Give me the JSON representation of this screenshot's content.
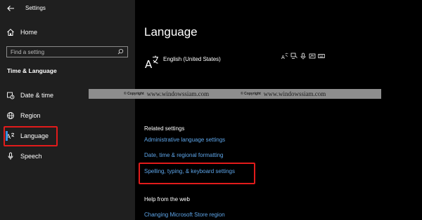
{
  "window": {
    "title": "Settings"
  },
  "sidebar": {
    "home_label": "Home",
    "search_placeholder": "Find a setting",
    "section_title": "Time & Language",
    "items": [
      {
        "label": "Date & time",
        "icon": "calendar-clock-icon"
      },
      {
        "label": "Region",
        "icon": "globe-icon"
      },
      {
        "label": "Language",
        "icon": "language-icon",
        "selected": true
      },
      {
        "label": "Speech",
        "icon": "microphone-icon"
      }
    ]
  },
  "main": {
    "page_title": "Language",
    "language_entry": {
      "name": "English (United States)",
      "icon": "language-icon"
    },
    "feature_icons": [
      "language-pack-icon",
      "text-to-speech-icon",
      "speech-recognition-icon",
      "handwriting-icon",
      "keyboard-icon"
    ],
    "related_settings": {
      "title": "Related settings",
      "links": [
        "Administrative language settings",
        "Date, time & regional formatting",
        "Spelling, typing, & keyboard settings"
      ]
    },
    "help_web": {
      "title": "Help from the web",
      "links": [
        "Changing Microsoft Store region"
      ]
    }
  },
  "watermark": {
    "copyright_label": "© Copyright",
    "site": "www.windowssiam.com"
  },
  "colors": {
    "sidebar_bg": "#1f1f1f",
    "main_bg": "#000000",
    "link": "#5ea6ea",
    "accent": "#3a8fde",
    "highlight_box": "#e21b1b",
    "watermark_bg": "#8d8d8d"
  }
}
